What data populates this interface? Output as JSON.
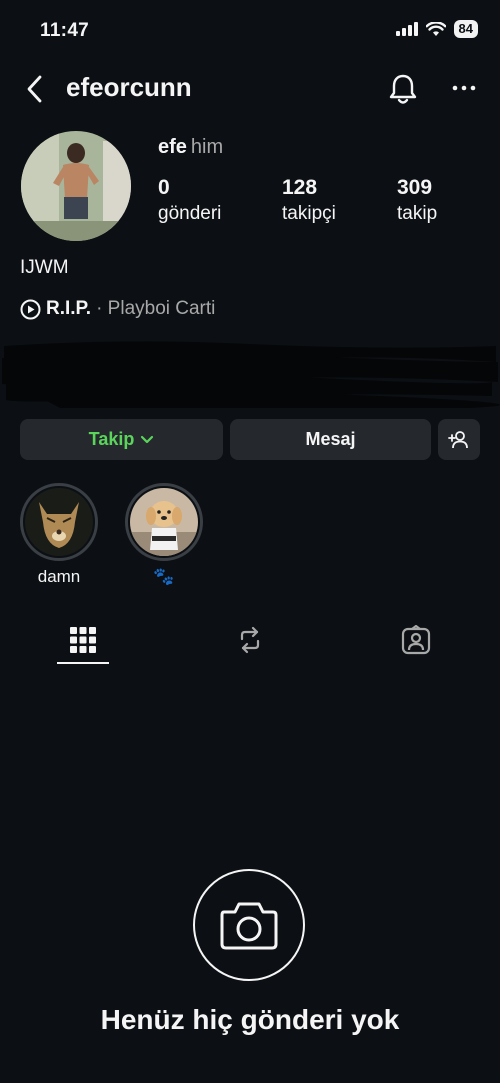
{
  "status_bar": {
    "time": "11:47",
    "battery": "84"
  },
  "header": {
    "username": "efeorcunn",
    "back_icon": "chevron-left-icon",
    "bell_icon": "bell-icon",
    "more_icon": "more-horizontal-icon"
  },
  "profile": {
    "name": "efe",
    "pronouns": "him",
    "stats": [
      {
        "value": "0",
        "label": "gönderi"
      },
      {
        "value": "128",
        "label": "takipçi"
      },
      {
        "value": "309",
        "label": "takip"
      }
    ],
    "bio": "IJWM",
    "music": {
      "song": "R.I.P.",
      "artist": "· Playboi Carti"
    }
  },
  "actions": {
    "follow_label": "Takip",
    "message_label": "Mesaj"
  },
  "highlights": [
    {
      "label": "damn"
    },
    {
      "label": "🐾"
    }
  ],
  "tabs": [
    "grid-icon",
    "reels-repost-icon",
    "tagged-icon"
  ],
  "empty_state": {
    "text": "Henüz hiç gönderi yok"
  },
  "colors": {
    "background": "#0c1014",
    "button": "#25292e",
    "follow_green": "#5ad45a",
    "muted": "#a8a8a8"
  }
}
